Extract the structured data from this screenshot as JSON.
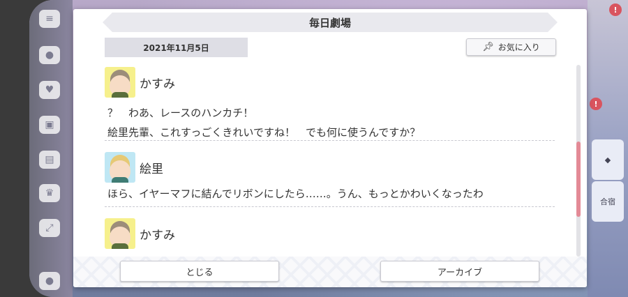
{
  "dialog": {
    "title": "毎日劇場",
    "date": "2021年11月5日",
    "favorite_label": "お気に入り",
    "entries": [
      {
        "speaker": "かすみ",
        "lines": [
          "？　わあ、レースのハンカチ！",
          "絵里先輩、これすっごくきれいですね！　でも何に使うんですか？"
        ]
      },
      {
        "speaker": "絵里",
        "lines": [
          "ほら、イヤーマフに結んでリボンにしたら……。うん、もっとかわいくなったわ"
        ]
      },
      {
        "speaker": "かすみ",
        "lines": []
      }
    ],
    "close_label": "とじる",
    "archive_label": "アーカイブ"
  },
  "background": {
    "right_card_label": "合宿",
    "colors": {
      "accent_scroll": "#e38a96",
      "badge": "#d9545f"
    }
  }
}
